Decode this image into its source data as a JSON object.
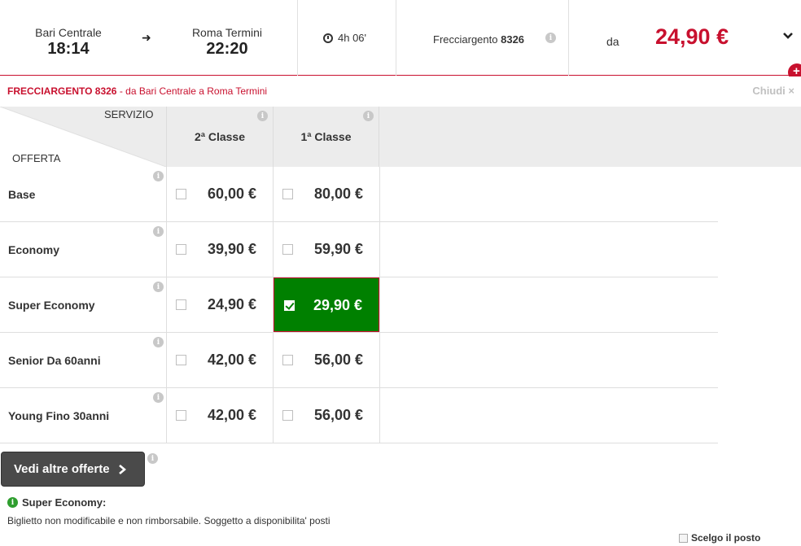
{
  "journey": {
    "departure_station": "Bari Centrale",
    "departure_time": "18:14",
    "arrival_station": "Roma Termini",
    "arrival_time": "22:20",
    "duration": "4h 06'",
    "train_type": "Frecciargento",
    "train_number": "8326",
    "price_prefix": "da",
    "price_from": "24,90 €"
  },
  "subheader": {
    "train": "FRECCIARGENTO 8326",
    "da": " - da ",
    "from": "Bari Centrale",
    "a": " a ",
    "to": "Roma Termini",
    "close_label": "Chiudi ×"
  },
  "grid": {
    "service_label": "SERVIZIO",
    "offer_label": "OFFERTA",
    "columns": [
      "2ª Classe",
      "1ª Classe"
    ],
    "rows": [
      {
        "label": "Base",
        "prices": [
          "60,00 €",
          "80,00 €"
        ]
      },
      {
        "label": "Economy",
        "prices": [
          "39,90 €",
          "59,90 €"
        ]
      },
      {
        "label": "Super Economy",
        "prices": [
          "24,90 €",
          "29,90 €"
        ]
      },
      {
        "label": "Senior Da 60anni",
        "prices": [
          "42,00 €",
          "56,00 €"
        ]
      },
      {
        "label": "Young Fino 30anni",
        "prices": [
          "42,00 €",
          "56,00 €"
        ]
      }
    ],
    "selected": {
      "row": 2,
      "col": 1
    }
  },
  "footer": {
    "more_offers_label": "Vedi altre offerte",
    "note_title": "Super Economy:",
    "note_text": "Biglietto non modificabile e non rimborsabile. Soggetto a disponibilita' posti",
    "seat_label": "Scelgo il posto"
  },
  "colors": {
    "accent": "#c8102e",
    "selected": "#008000"
  }
}
